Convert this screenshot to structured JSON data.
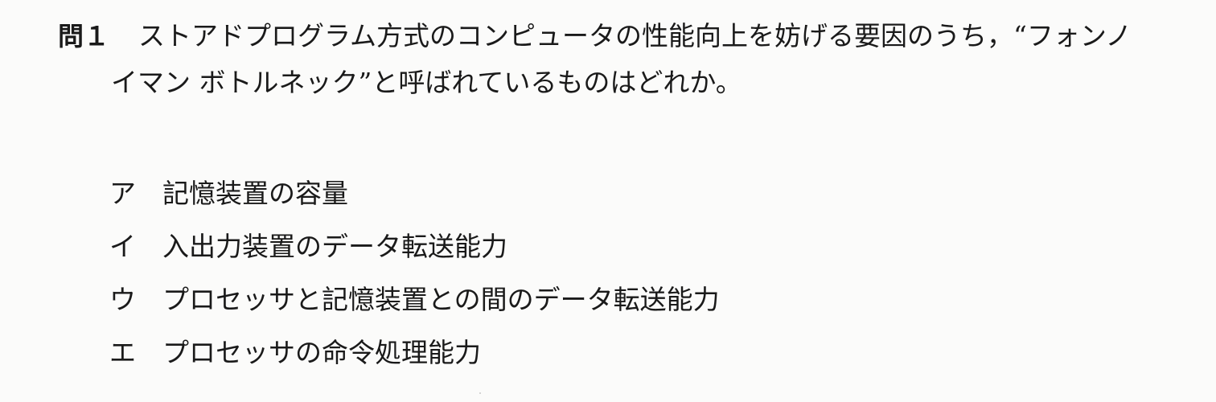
{
  "question": {
    "number": "問１",
    "lines": [
      "ストアドプログラム方式のコンピュータの性能向上を妨げる要因のうち，“フォンノ",
      "イマン ボトルネック”と呼ばれているものはどれか。"
    ]
  },
  "choices": [
    {
      "label": "ア",
      "text": "記憶装置の容量"
    },
    {
      "label": "イ",
      "text": "入出力装置のデータ転送能力"
    },
    {
      "label": "ウ",
      "text": "プロセッサと記憶装置との間のデータ転送能力"
    },
    {
      "label": "エ",
      "text": "プロセッサの命令処理能力"
    }
  ],
  "colors": {
    "background": "#fbfbfa",
    "text": "#1a1a1a"
  }
}
